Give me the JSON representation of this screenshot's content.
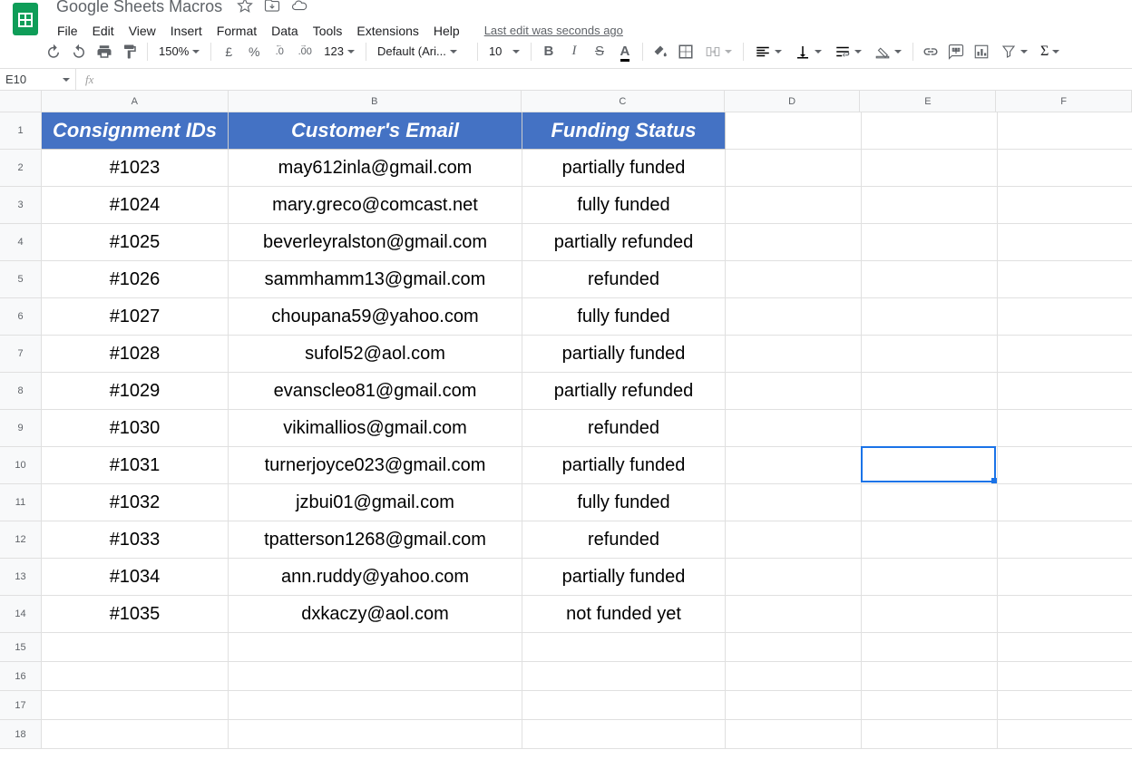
{
  "doc": {
    "title": "Google Sheets Macros"
  },
  "menu": {
    "file": "File",
    "edit": "Edit",
    "view": "View",
    "insert": "Insert",
    "format": "Format",
    "data": "Data",
    "tools": "Tools",
    "extensions": "Extensions",
    "help": "Help",
    "last_edit": "Last edit was seconds ago"
  },
  "toolbar": {
    "zoom": "150%",
    "currency": "£",
    "percent": "%",
    "dec_dec": ".0",
    "inc_dec": ".00",
    "num_fmt": "123",
    "font": "Default (Ari...",
    "font_size": "10"
  },
  "namebox": {
    "cell": "E10"
  },
  "columns": [
    "A",
    "B",
    "C",
    "D",
    "E",
    "F"
  ],
  "header_row": {
    "a": "Consignment IDs",
    "b": "Customer's Email",
    "c": "Funding Status"
  },
  "rows": [
    {
      "n": "1"
    },
    {
      "n": "2",
      "a": "#1023",
      "b": "may612inla@gmail.com",
      "c": "partially funded"
    },
    {
      "n": "3",
      "a": "#1024",
      "b": "mary.greco@comcast.net",
      "c": "fully funded"
    },
    {
      "n": "4",
      "a": "#1025",
      "b": "beverleyralston@gmail.com",
      "c": "partially refunded"
    },
    {
      "n": "5",
      "a": "#1026",
      "b": "sammhamm13@gmail.com",
      "c": "refunded"
    },
    {
      "n": "6",
      "a": "#1027",
      "b": "choupana59@yahoo.com",
      "c": "fully funded"
    },
    {
      "n": "7",
      "a": "#1028",
      "b": "sufol52@aol.com",
      "c": "partially funded"
    },
    {
      "n": "8",
      "a": "#1029",
      "b": "evanscleo81@gmail.com",
      "c": "partially refunded"
    },
    {
      "n": "9",
      "a": "#1030",
      "b": "vikimallios@gmail.com",
      "c": "refunded"
    },
    {
      "n": "10",
      "a": "#1031",
      "b": "turnerjoyce023@gmail.com",
      "c": "partially funded"
    },
    {
      "n": "11",
      "a": "#1032",
      "b": "jzbui01@gmail.com",
      "c": "fully funded"
    },
    {
      "n": "12",
      "a": "#1033",
      "b": "tpatterson1268@gmail.com",
      "c": "refunded"
    },
    {
      "n": "13",
      "a": "#1034",
      "b": "ann.ruddy@yahoo.com",
      "c": "partially funded"
    },
    {
      "n": "14",
      "a": "#1035",
      "b": "dxkaczy@aol.com",
      "c": "not funded yet"
    },
    {
      "n": "15"
    },
    {
      "n": "16"
    },
    {
      "n": "17"
    },
    {
      "n": "18"
    }
  ],
  "active": {
    "col": "E",
    "row": 10
  }
}
